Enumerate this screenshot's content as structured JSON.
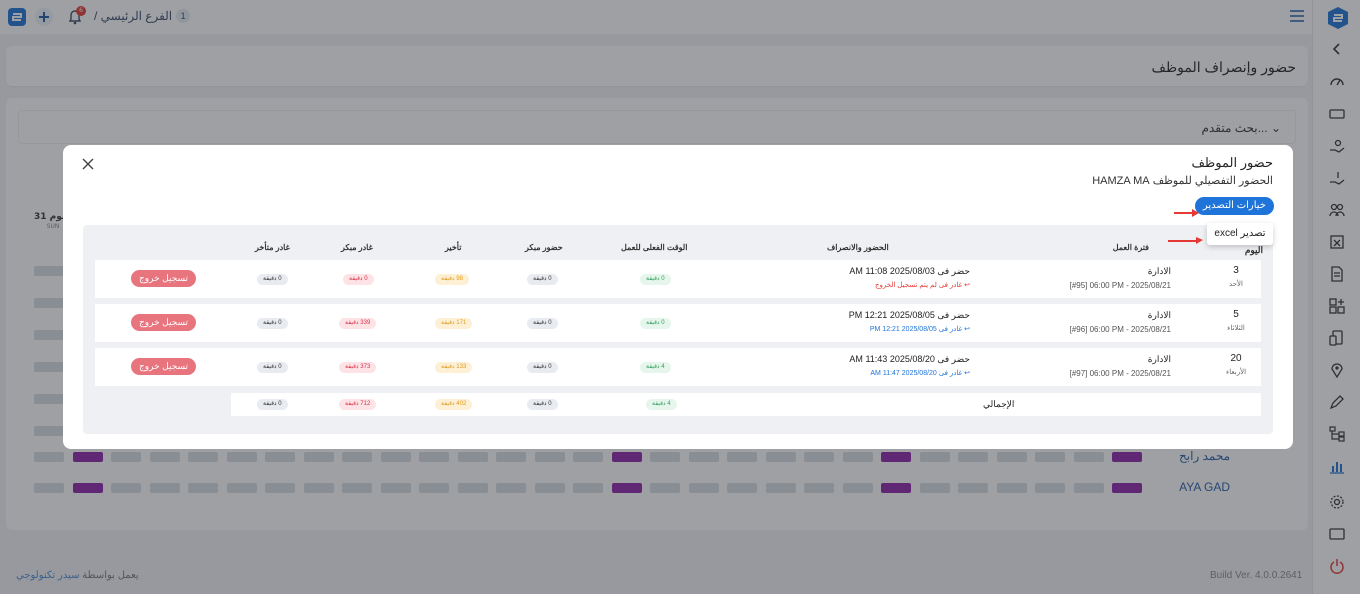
{
  "topbar": {
    "branch_num": "1",
    "branch_label": "الفرع الرئيسي /",
    "notification_count": "6"
  },
  "page": {
    "title": "حضور وإنصراف الموظف"
  },
  "advanced_search": {
    "label": "بحث متقدم..."
  },
  "background_table": {
    "day_label": "اليوم 31",
    "day_sub": "SUN",
    "names": [
      "محمد رابح",
      "AYA GAD"
    ]
  },
  "footer": {
    "powered_prefix": "يعمل بواسطة",
    "powered_link": "سيدر تكنولوجي",
    "build": "Build Ver. 4.0.0.2641"
  },
  "modal": {
    "title": "حضور الموظف",
    "subtitle": "الحضور التفصيلي للموظف HAMZA MA",
    "export_button": "خيارات التصدير",
    "export_menu_item": "تصدير excel",
    "headers": {
      "day": "اليوم",
      "shift": "فترة العمل",
      "attendance": "الحضور والانصراف",
      "actual": "الوقت الفعلى للعمل",
      "early_arrival": "حضور مبكر",
      "delay": "تأخير",
      "early_leave": "غادر مبكر",
      "late_leave": "غادر متأخر"
    },
    "rows": [
      {
        "day_num": "3",
        "day_name": "الأحد",
        "shift_name": "الادارة",
        "shift_time": "[#95] 06:00 PM - 2025/08/21",
        "checkin": "حضر فى 2025/08/03 11:08 AM",
        "checkout_note": "↩ غادر فى لم يتم تسجيل الخروج",
        "actual": "0 دقيقة",
        "early_arrival": "0 دقيقة",
        "delay": "98 دقيقة",
        "early_leave": "0 دقيقة",
        "late_leave": "0 دقيقة",
        "action": "تسجيل خروج"
      },
      {
        "day_num": "5",
        "day_name": "الثلاثاء",
        "shift_name": "الادارة",
        "shift_time": "[#96] 06:00 PM - 2025/08/21",
        "checkin": "حضر فى 2025/08/05 12:21 PM",
        "checkout_note": "↩ غادر فى 2025/08/05 12:21 PM",
        "actual": "0 دقيقة",
        "early_arrival": "0 دقيقة",
        "delay": "171 دقيقة",
        "early_leave": "339 دقيقة",
        "late_leave": "0 دقيقة",
        "action": "تسجيل خروج"
      },
      {
        "day_num": "20",
        "day_name": "الأربعاء",
        "shift_name": "الادارة",
        "shift_time": "[#97] 06:00 PM - 2025/08/21",
        "checkin": "حضر فى 2025/08/20 11:43 AM",
        "checkout_note": "↩ غادر فى 2025/08/20 11:47 AM",
        "actual": "4 دقيقة",
        "early_arrival": "0 دقيقة",
        "delay": "133 دقيقة",
        "early_leave": "373 دقيقة",
        "late_leave": "0 دقيقة",
        "action": "تسجيل خروج"
      }
    ],
    "total": {
      "label": "الإجمالي",
      "actual": "4 دقيقة",
      "early_arrival": "0 دقيقة",
      "delay": "402 دقيقة",
      "early_leave": "712 دقيقة",
      "late_leave": "0 دقيقة"
    }
  },
  "colors": {
    "accent": "#1e74d8",
    "danger": "#e53935",
    "purple": "#8e24aa"
  }
}
